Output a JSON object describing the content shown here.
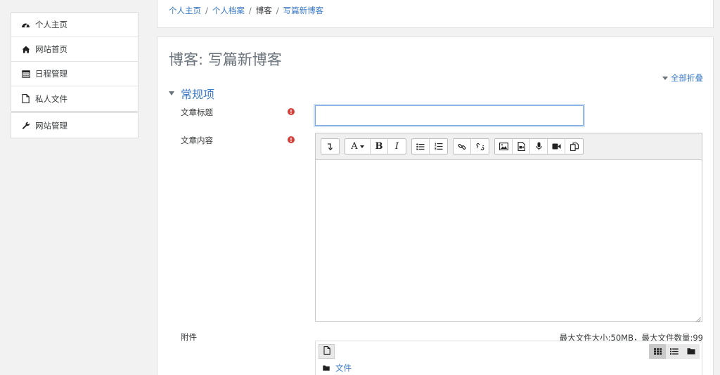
{
  "sidebar": {
    "items": [
      {
        "label": "个人主页",
        "icon": "dashboard-icon"
      },
      {
        "label": "网站首页",
        "icon": "home-icon"
      },
      {
        "label": "日程管理",
        "icon": "calendar-icon"
      },
      {
        "label": "私人文件",
        "icon": "file-icon"
      }
    ],
    "admin": {
      "label": "网站管理",
      "icon": "wrench-icon"
    }
  },
  "breadcrumb": {
    "items": [
      {
        "label": "个人主页",
        "link": true
      },
      {
        "label": "个人档案",
        "link": true
      },
      {
        "label": "博客",
        "link": false
      },
      {
        "label": "写篇新博客",
        "link": true
      }
    ],
    "separator": "/"
  },
  "page": {
    "title": "博客: 写篇新博客",
    "collapse_all": "全部折叠",
    "section_title": "常规项"
  },
  "form": {
    "title_label": "文章标题",
    "title_value": "",
    "content_label": "文章内容",
    "attachments_label": "附件",
    "required_mark": "!",
    "limits_text": "最大文件大小:50MB，最大文件数量:99",
    "folder_label": "文件"
  },
  "toolbar": {
    "font_label": "A",
    "bold_label": "B",
    "italic_label": "I"
  },
  "colors": {
    "accent": "#3a79c8",
    "required": "#d43f3a",
    "muted": "#6a737b"
  }
}
